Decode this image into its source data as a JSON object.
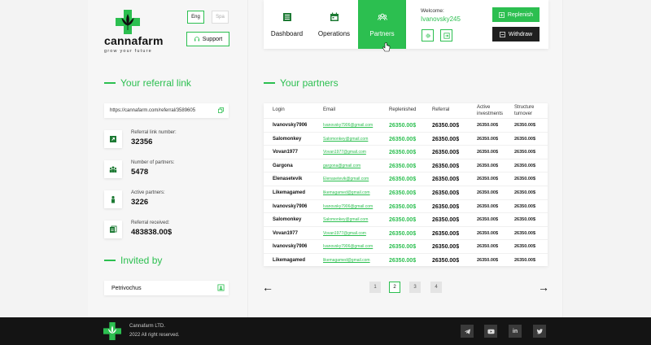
{
  "brand": {
    "name": "cannafarm",
    "tagline": "grow your future"
  },
  "header": {
    "langs": [
      {
        "label": "Eng",
        "active": true
      },
      {
        "label": "Spa",
        "active": false
      }
    ],
    "support_label": "Support",
    "tabs": [
      {
        "label": "Dashboard",
        "icon": "dashboard-icon",
        "active": false
      },
      {
        "label": "Operations",
        "icon": "calendar-icon",
        "active": false
      },
      {
        "label": "Partners",
        "icon": "partners-icon",
        "active": true
      }
    ],
    "welcome_label": "Welcome:",
    "username": "Ivanovsky245",
    "replenish_label": "Replenish",
    "withdraw_label": "Withdraw"
  },
  "referral": {
    "title": "Your referral link",
    "link": "https://cannafarm.com/referral/3589605",
    "stats": [
      {
        "label": "Referral link number:",
        "value": "32356",
        "icon": "link-icon"
      },
      {
        "label": "Number of partners:",
        "value": "5478",
        "icon": "group-icon"
      },
      {
        "label": "Active partners:",
        "value": "3226",
        "icon": "person-icon"
      },
      {
        "label": "Referral received:",
        "value": "483838.00$",
        "icon": "money-icon"
      }
    ]
  },
  "invited": {
    "title": "Invited by",
    "name": "Petrivochus"
  },
  "partners": {
    "title": "Your partners",
    "columns": [
      "Login",
      "Email",
      "Replenished",
      "Referral",
      "Active investments",
      "Structure turnover"
    ],
    "rows": [
      {
        "login": "Ivanovsky7906",
        "email": "Ivanovsky7906@gmail.com",
        "replenished": "26350.00$",
        "referral": "26350.00$",
        "active": "26350.00$",
        "turnover": "26350.00$"
      },
      {
        "login": "Salomonkey",
        "email": "Salomonkey@gmail.com",
        "replenished": "26350.00$",
        "referral": "26350.00$",
        "active": "26350.00$",
        "turnover": "26350.00$"
      },
      {
        "login": "Vovan1977",
        "email": "Vovan1977@gmail.com",
        "replenished": "26350.00$",
        "referral": "26350.00$",
        "active": "26350.00$",
        "turnover": "26350.00$"
      },
      {
        "login": "Gargona",
        "email": "gargona@gmail.com",
        "replenished": "26350.00$",
        "referral": "26350.00$",
        "active": "26350.00$",
        "turnover": "26350.00$"
      },
      {
        "login": "Elenasetevik",
        "email": "Elenasetevik@gmail.com",
        "replenished": "26350.00$",
        "referral": "26350.00$",
        "active": "26350.00$",
        "turnover": "26350.00$"
      },
      {
        "login": "Likemagamed",
        "email": "likemagamed@gmail.com",
        "replenished": "26350.00$",
        "referral": "26350.00$",
        "active": "26350.00$",
        "turnover": "26350.00$"
      },
      {
        "login": "Ivanovsky7906",
        "email": "Ivanovsky7906@gmail.com",
        "replenished": "26350.00$",
        "referral": "26350.00$",
        "active": "26350.00$",
        "turnover": "26350.00$"
      },
      {
        "login": "Salomonkey",
        "email": "Salomonkey@gmail.com",
        "replenished": "26350.00$",
        "referral": "26350.00$",
        "active": "26350.00$",
        "turnover": "26350.00$"
      },
      {
        "login": "Vovan1977",
        "email": "Vovan1977@gmail.com",
        "replenished": "26350.00$",
        "referral": "26350.00$",
        "active": "26350.00$",
        "turnover": "26350.00$"
      },
      {
        "login": "Ivanovsky7906",
        "email": "Ivanovsky7906@gmail.com",
        "replenished": "26350.00$",
        "referral": "26350.00$",
        "active": "26350.00$",
        "turnover": "26350.00$"
      },
      {
        "login": "Likemagamed",
        "email": "likemagamed@gmail.com",
        "replenished": "26350.00$",
        "referral": "26350.00$",
        "active": "26350.00$",
        "turnover": "26350.00$"
      }
    ],
    "pages": [
      "1",
      "2",
      "3",
      "4"
    ],
    "current_page": "2",
    "prev_arrow": "←",
    "next_arrow": "→"
  },
  "footer": {
    "company": "Cannafarm LTD.",
    "rights": "2022 All right reserved.",
    "socials": [
      "telegram-icon",
      "youtube-icon",
      "linkedin-icon",
      "twitter-icon"
    ],
    "linkedin_text": "in"
  },
  "colors": {
    "accent": "#2cbf50",
    "dark": "#1a1a1a",
    "footer": "#141414"
  }
}
